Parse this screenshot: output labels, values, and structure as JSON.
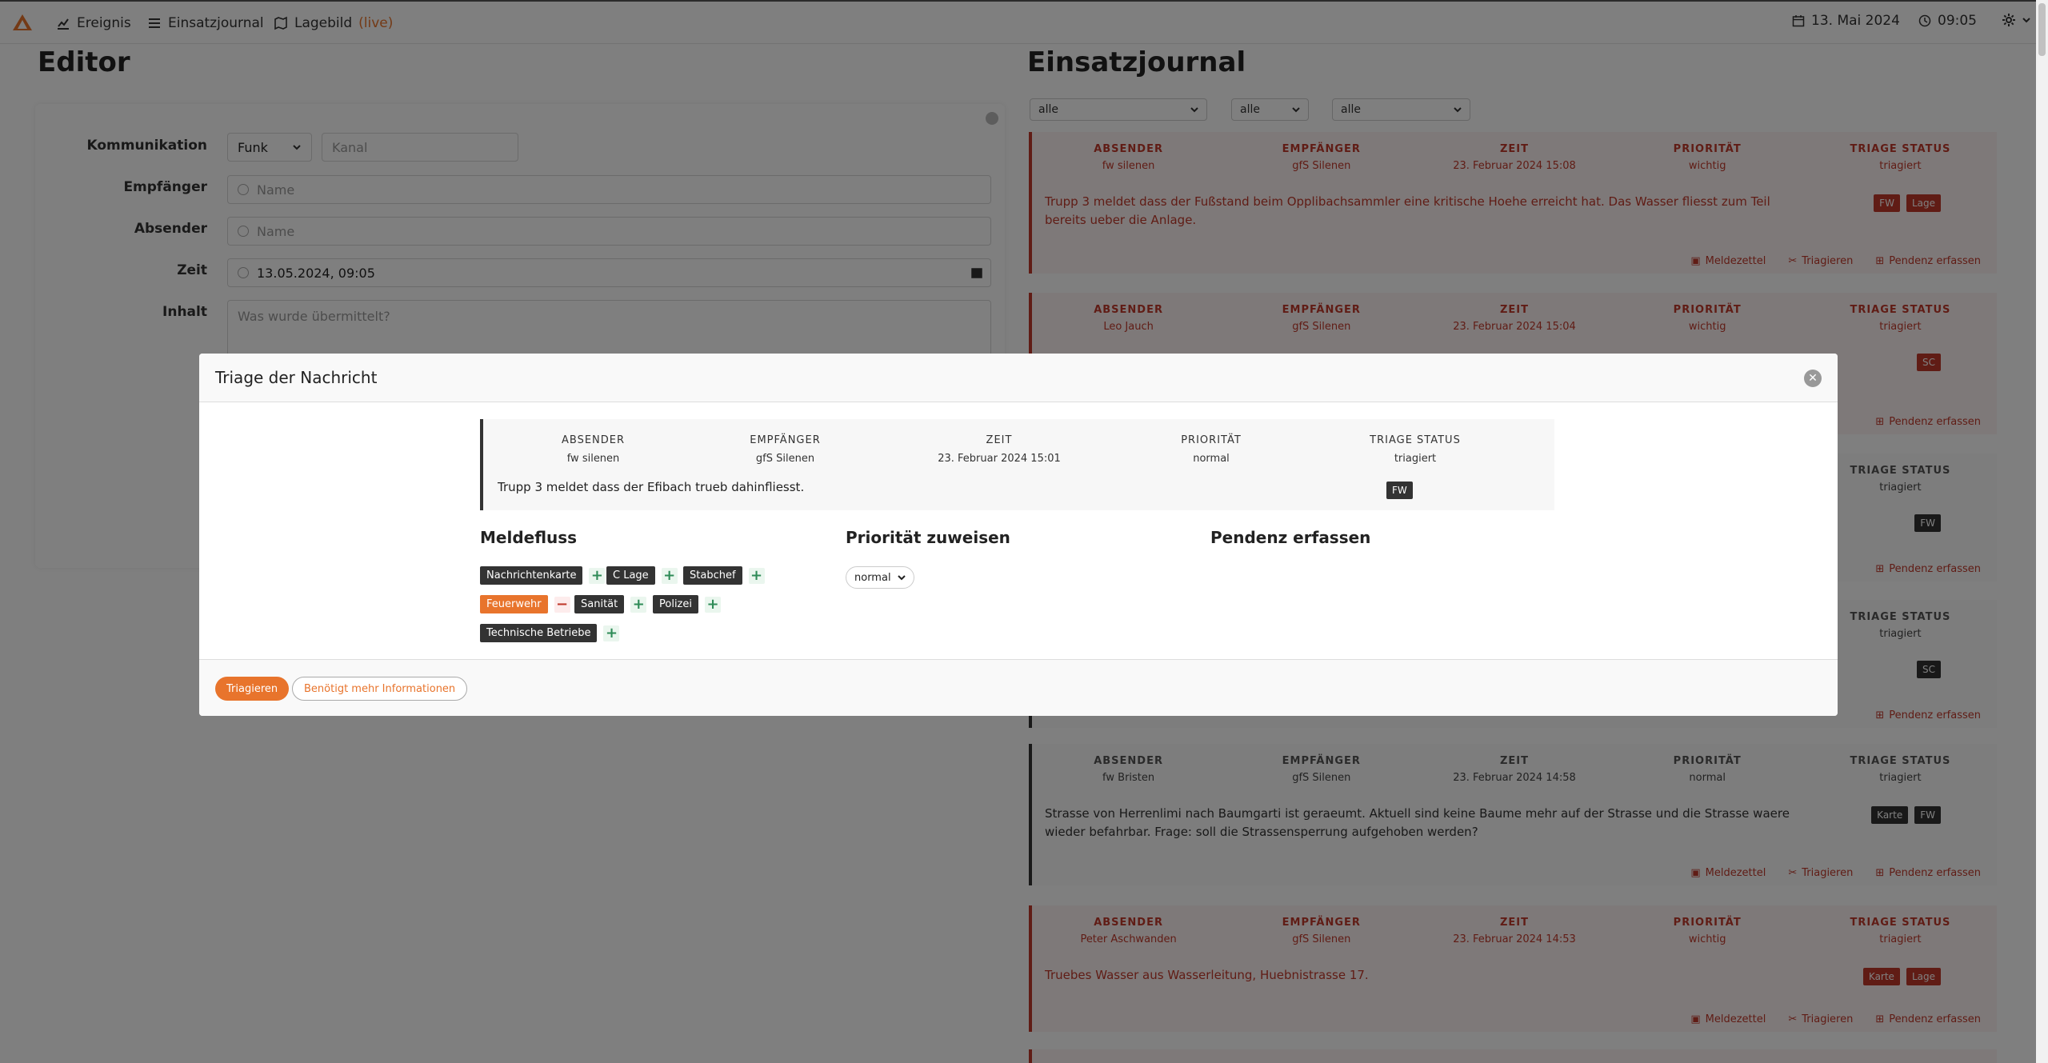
{
  "nav": {
    "ereignis": "Ereignis",
    "einsatzjournal": "Einsatzjournal",
    "lagebild": "Lagebild",
    "live": "(live)",
    "date": "13. Mai 2024",
    "time": "09:05"
  },
  "editor": {
    "title": "Editor",
    "labels": {
      "kommunikation": "Kommunikation",
      "empfaenger": "Empfänger",
      "absender": "Absender",
      "zeit": "Zeit",
      "inhalt": "Inhalt"
    },
    "kommunikation_value": "Funk",
    "kanal_placeholder": "Kanal",
    "empfaenger_placeholder": "Name",
    "absender_placeholder": "Name",
    "zeit_value": "13.05.2024, 09:05",
    "inhalt_placeholder": "Was wurde übermittelt?"
  },
  "journal": {
    "title": "Einsatzjournal",
    "filters": [
      "alle",
      "alle",
      "alle"
    ],
    "headers": {
      "absender": "ABSENDER",
      "empfaenger": "EMPFÄNGER",
      "zeit": "ZEIT",
      "prioritaet": "PRIORITÄT",
      "triage": "TRIAGE STATUS"
    },
    "actions": {
      "meldezettel": "Meldezettel",
      "triagieren": "Triagieren",
      "pendenz": "Pendenz erfassen"
    },
    "entries": [
      {
        "absender": "fw silenen",
        "empfaenger": "gfS Silenen",
        "zeit": "23. Februar 2024 15:08",
        "prioritaet": "wichtig",
        "triage": "triagiert",
        "content": "Trupp 3 meldet dass der Fußstand beim Opplibachsammler eine kritische Hoehe erreicht hat. Das Wasser fliesst zum Teil bereits ueber die Anlage.",
        "tags": [
          "FW",
          "Lage"
        ]
      },
      {
        "absender": "Leo Jauch",
        "empfaenger": "gfS Silenen",
        "zeit": "23. Februar 2024 15:04",
        "prioritaet": "wichtig",
        "triage": "triagiert",
        "tags": [
          "SC"
        ]
      },
      {
        "triage": "triagiert",
        "tags": [
          "FW"
        ]
      },
      {
        "triage": "triagiert",
        "tags": [
          "SC"
        ]
      },
      {
        "absender": "fw Bristen",
        "empfaenger": "gfS Silenen",
        "zeit": "23. Februar 2024 14:58",
        "prioritaet": "normal",
        "triage": "triagiert",
        "content": "Strasse von Herrenlimi nach Baumgarti ist geraeumt. Aktuell sind keine Baume mehr auf der Strasse und die Strasse waere wieder befahrbar. Frage: soll die Strassensperrung aufgehoben werden?",
        "tags": [
          "Karte",
          "FW"
        ]
      },
      {
        "absender": "Peter Aschwanden",
        "empfaenger": "gfS Silenen",
        "zeit": "23. Februar 2024 14:53",
        "prioritaet": "wichtig",
        "triage": "triagiert",
        "content": "Truebes Wasser aus Wasserleitung, Huebnistrasse 17.",
        "tags": [
          "Karte",
          "Lage"
        ]
      }
    ]
  },
  "modal": {
    "title": "Triage der Nachricht",
    "message": {
      "absender_label": "ABSENDER",
      "absender": "fw silenen",
      "empfaenger_label": "EMPFÄNGER",
      "empfaenger": "gfS Silenen",
      "zeit_label": "ZEIT",
      "zeit": "23. Februar 2024 15:01",
      "prioritaet_label": "PRIORITÄT",
      "prioritaet": "normal",
      "triage_label": "TRIAGE STATUS",
      "triage": "triagiert",
      "content": "Trupp 3 meldet dass der Efibach trueb dahinfliesst.",
      "tag": "FW"
    },
    "meldefluss_title": "Meldefluss",
    "prioritaet_title": "Priorität zuweisen",
    "pendenz_title": "Pendenz erfassen",
    "meldefluss": [
      "Nachrichtenkarte",
      "C Lage",
      "Stabchef",
      "Feuerwehr",
      "Sanität",
      "Polizei",
      "Technische Betriebe"
    ],
    "prioritaet_value": "normal",
    "btn_triagieren": "Triagieren",
    "btn_mehr_info": "Benötigt mehr Informationen"
  },
  "colors": {
    "accent": "#e8742c",
    "urgent": "#c0392b",
    "dark_tag": "#333333"
  }
}
